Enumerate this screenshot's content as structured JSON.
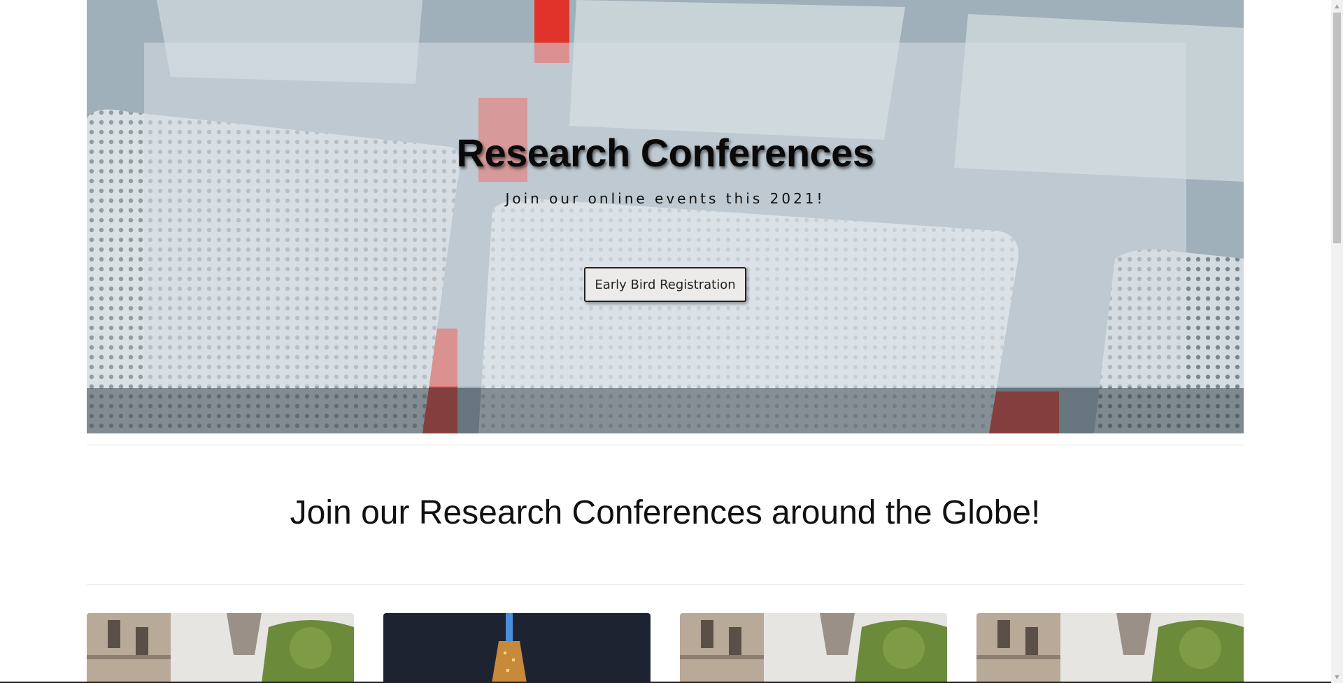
{
  "hero": {
    "title": "Research Conferences",
    "subtitle": "Join our online events this 2021!",
    "button_label": "Early Bird Registration",
    "background_image": "conference-hall-seats-photo"
  },
  "section": {
    "heading": "Join our Research Conferences around the Globe!"
  },
  "cards": [
    {
      "image": "paris-eiffel-tower-street-photo"
    },
    {
      "image": "night-skyscraper-lights-photo"
    },
    {
      "image": "paris-eiffel-tower-street-photo"
    },
    {
      "image": "paris-eiffel-tower-street-photo"
    }
  ],
  "colors": {
    "seat_red": "#e0332c",
    "seat_gray": "#b9c6cd",
    "overlay": "#d7dee4"
  }
}
